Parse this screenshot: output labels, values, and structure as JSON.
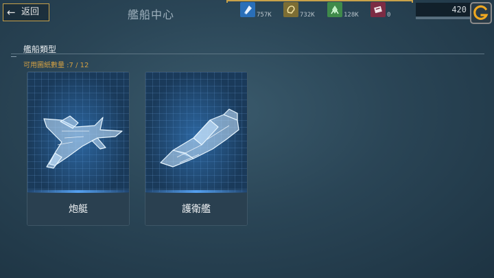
{
  "header": {
    "back_label": "返回",
    "title": "艦船中心"
  },
  "resources": [
    {
      "icon": "blue-crystal-icon",
      "value": "757K",
      "color": "#2a6fb8"
    },
    {
      "icon": "gold-ore-icon",
      "value": "732K",
      "color": "#8a7a3a"
    },
    {
      "icon": "green-gas-icon",
      "value": "128K",
      "color": "#3f8a4a"
    },
    {
      "icon": "red-card-icon",
      "value": "0",
      "color": "#8a3048"
    }
  ],
  "gold": {
    "value": "420",
    "icon": "g-coin-icon"
  },
  "section": {
    "title": "艦船類型",
    "blueprint_text": "可用圖紙數量 :7 / 12"
  },
  "ships": [
    {
      "name": "炮艇",
      "icon": "gunboat-hologram-icon"
    },
    {
      "name": "護衛艦",
      "icon": "frigate-hologram-icon"
    }
  ]
}
